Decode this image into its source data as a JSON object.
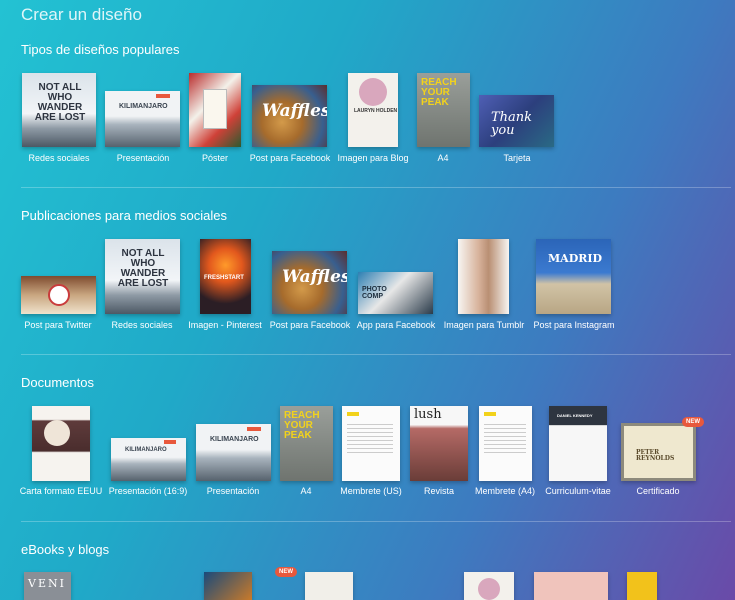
{
  "page": {
    "title": "Crear un diseño"
  },
  "sections": {
    "popular": {
      "title": "Tipos de diseños populares",
      "items": [
        "Redes sociales",
        "Presentación",
        "Póster",
        "Post para Facebook",
        "Imagen para Blog",
        "A4",
        "Tarjeta"
      ]
    },
    "social": {
      "title": "Publicaciones para medios sociales",
      "items": [
        "Post para Twitter",
        "Redes sociales",
        "Imagen - Pinterest",
        "Post para Facebook",
        "App para Facebook",
        "Imagen para Tumblr",
        "Post para Instagram"
      ]
    },
    "documents": {
      "title": "Documentos",
      "items": [
        "Carta formato EEUU",
        "Presentación (16:9)",
        "Presentación",
        "A4",
        "Membrete (US)",
        "Revista",
        "Membrete (A4)",
        "Curriculum-vitae",
        "Certificado"
      ]
    },
    "ebooks": {
      "title": "eBooks y blogs"
    }
  },
  "thumb_text": {
    "not_all": "NOT ALL WHO WANDER ARE LOST",
    "kilimanjaro": "KILIMANJARO",
    "waffles": "Waffles",
    "lauryn": "LAURYN HOLDEN",
    "reach": "REACH YOUR PEAK",
    "thank_you": "Thank you",
    "freshstart": "FRESHSTART",
    "photo_comp": "PHOTO COMP",
    "madrid": "MADRID",
    "lush": "lush",
    "daniel": "DANIEL KENNEDY",
    "peter": "PETER REYNOLDS",
    "veni": "VENI",
    "new": "NEW"
  },
  "colors": {
    "badge": "#e8583c",
    "accent_yellow": "#f2d21b"
  }
}
